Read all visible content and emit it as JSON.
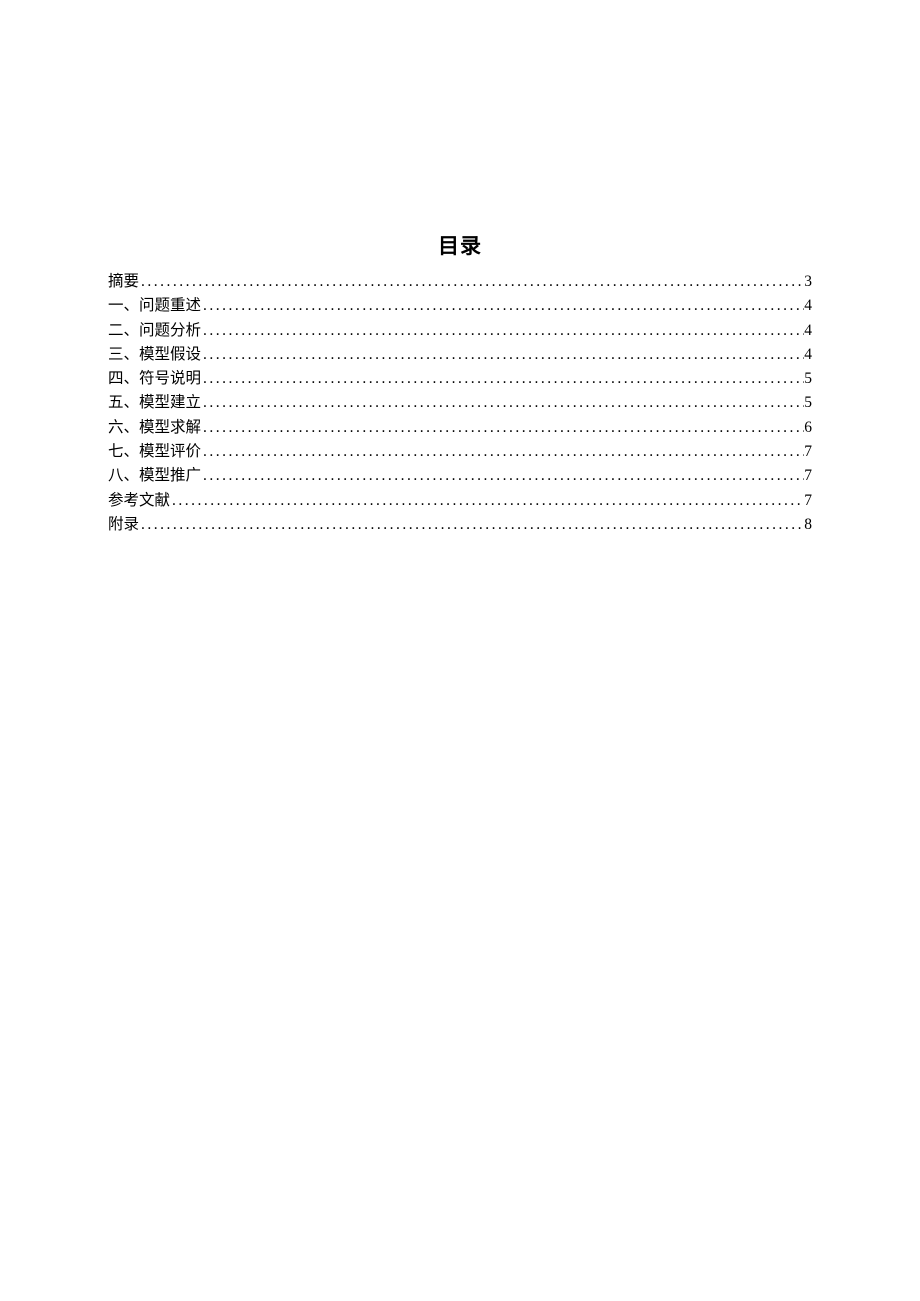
{
  "title": "目录",
  "toc": [
    {
      "label": "摘要",
      "page": "3"
    },
    {
      "label": "一、问题重述",
      "page": "4"
    },
    {
      "label": "二、问题分析",
      "page": "4"
    },
    {
      "label": "三、模型假设",
      "page": "4"
    },
    {
      "label": "四、符号说明",
      "page": "5"
    },
    {
      "label": "五、模型建立",
      "page": "5"
    },
    {
      "label": "六、模型求解",
      "page": "6"
    },
    {
      "label": "七、模型评价",
      "page": "7"
    },
    {
      "label": "八、模型推广",
      "page": "7"
    },
    {
      "label": "参考文献",
      "page": "7"
    },
    {
      "label": "附录",
      "page": "8"
    }
  ]
}
